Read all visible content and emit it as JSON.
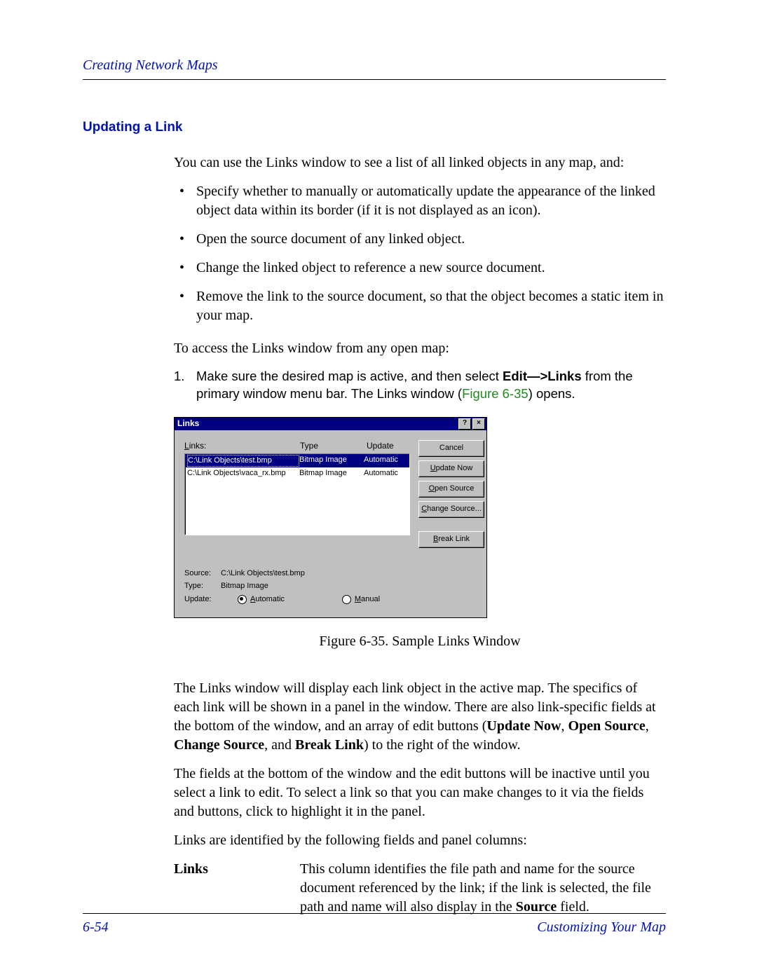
{
  "header": {
    "section_title": "Creating Network Maps"
  },
  "section": {
    "heading": "Updating a Link"
  },
  "body": {
    "intro": "You can use the Links window to see a list of all linked objects in any map, and:",
    "bullets": [
      "Specify whether to manually or automatically update the appearance of the linked object data within its border (if it is not displayed as an icon).",
      "Open the source document of any linked object.",
      "Change the linked object to reference a new source document.",
      "Remove the link to the source document, so that the object becomes a static item in your map."
    ],
    "access_line": "To access the Links window from any open map:",
    "step1": {
      "num": "1.",
      "pre_bold": "Make sure the desired map is active, and then select ",
      "bold1": "Edit—>Links",
      "mid": " from the primary window menu bar. The Links window (",
      "figref": "Figure 6-35",
      "post": ") opens."
    }
  },
  "dialog": {
    "title": "Links",
    "help_btn": "?",
    "close_btn": "×",
    "headers": {
      "links": "Links:",
      "type": "Type",
      "update": "Update"
    },
    "rows": [
      {
        "path": "C:\\Link Objects\\test.bmp",
        "type": "Bitmap Image",
        "update": "Automatic",
        "selected": true
      },
      {
        "path": "C:\\Link Objects\\vaca_rx.bmp",
        "type": "Bitmap Image",
        "update": "Automatic",
        "selected": false
      }
    ],
    "buttons": {
      "cancel": "Cancel",
      "update_now": "Update Now",
      "open_source": "Open Source",
      "change_source": "Change Source...",
      "break_link": "Break Link"
    },
    "fields": {
      "source_label": "Source:",
      "source_value": "C:\\Link Objects\\test.bmp",
      "type_label": "Type:",
      "type_value": "Bitmap Image",
      "update_label": "Update:",
      "automatic": "Automatic",
      "manual": "Manual"
    }
  },
  "caption": "Figure 6-35.  Sample Links Window",
  "after": {
    "p1_a": "The Links window will display each link object in the active map. The specifics of each link will be shown in a panel in the window. There are also link-specific fields at the bottom of the window, and an array of edit buttons (",
    "p1_b1": "Update Now",
    "p1_sep1": ", ",
    "p1_b2": "Open Source",
    "p1_sep2": ", ",
    "p1_b3": "Change Source",
    "p1_sep3": ", and ",
    "p1_b4": "Break Link",
    "p1_c": ") to the right of the window.",
    "p2": "The fields at the bottom of the window and the edit buttons will be inactive until you select a link to edit. To select a link so that you can make changes to it via the fields and buttons, click to highlight it in the panel.",
    "p3": "Links are identified by the following fields and panel columns:",
    "def_term": "Links",
    "def_desc_a": "This column identifies the file path and name for the source document referenced by the link; if the link is selected, the file path and name will also display in the ",
    "def_desc_b": "Source",
    "def_desc_c": " field."
  },
  "footer": {
    "page_num": "6-54",
    "right": "Customizing Your Map"
  }
}
